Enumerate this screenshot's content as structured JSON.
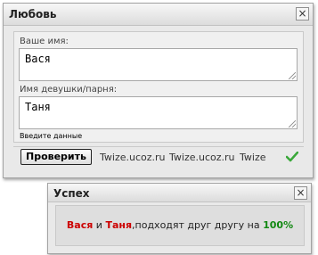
{
  "main_dialog": {
    "title": "Любовь",
    "close": "×",
    "your_name_label": "Ваше имя:",
    "your_name_value": "Вася",
    "partner_label": "Имя девушки/парня:",
    "partner_value": "Таня",
    "hint": "Введите данные",
    "check_button": "Проверить",
    "links": [
      "Twize.ucoz.ru",
      "Twize.ucoz.ru",
      "Twize"
    ]
  },
  "success_dialog": {
    "title": "Успех",
    "close": "×",
    "name1": "Вася",
    "conj": " и ",
    "name2": "Таня",
    "text": ",подходят друг другу на ",
    "percent": "100%"
  },
  "colors": {
    "accent_red": "#cc0000",
    "accent_green": "#118811"
  }
}
